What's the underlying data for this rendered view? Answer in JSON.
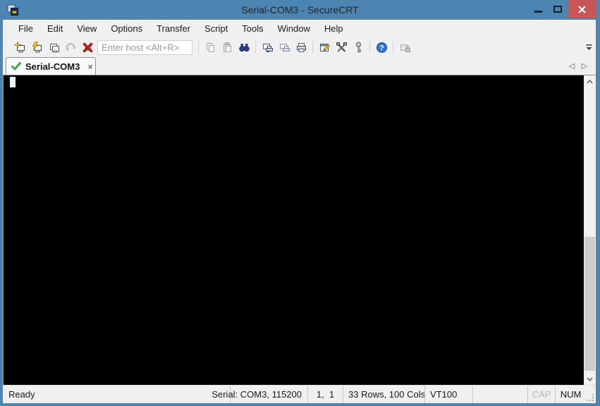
{
  "window": {
    "title": "Serial-COM3 - SecureCRT",
    "controls": [
      "minimize",
      "maximize",
      "close"
    ]
  },
  "menu": {
    "items": [
      "File",
      "Edit",
      "View",
      "Options",
      "Transfer",
      "Script",
      "Tools",
      "Window",
      "Help"
    ]
  },
  "toolbar": {
    "host_placeholder": "Enter host <Alt+R>",
    "icons": [
      "quick-connect",
      "connect",
      "connect-in-tab",
      "reconnect",
      "disconnect",
      "copy",
      "paste",
      "find",
      "print-echo",
      "print-setup",
      "print",
      "session-options",
      "global-options",
      "key-agent",
      "help",
      "session-locked",
      "toolbar-overflow"
    ]
  },
  "tab_bar": {
    "tabs": [
      {
        "label": "Serial-COM3",
        "close_glyph": "×",
        "status": "connected"
      }
    ],
    "scroll_left": "◁",
    "scroll_right": "▷"
  },
  "terminal": {
    "cursor_visible": true,
    "text": ""
  },
  "status_bar": {
    "ready": "Ready",
    "connection": "Serial: COM3, 115200",
    "cursor_position": "1,  1",
    "terminal_size": "33 Rows, 100 Cols",
    "emulation": "VT100",
    "caps_lock": "CAP",
    "num_lock": "NUM"
  },
  "colors": {
    "titlebar": "#4d85b2",
    "close_button": "#c75656",
    "chrome_bg": "#f0f0f0",
    "terminal_bg": "#000000",
    "tab_check_green": "#3fa84c"
  }
}
